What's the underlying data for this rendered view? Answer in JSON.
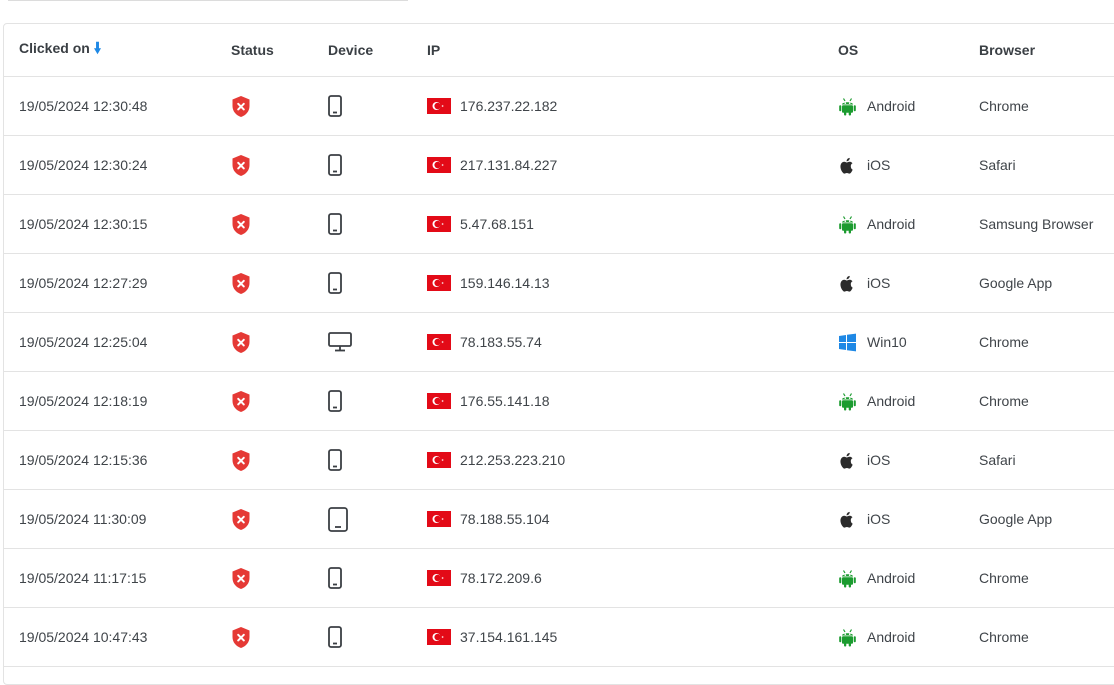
{
  "colors": {
    "accent": "#1e88e5",
    "status_blocked": "#e53935",
    "android": "#1b9b2f",
    "ios": "#2b2b2b",
    "windows": "#1e88e5",
    "flag_red": "#e30a17"
  },
  "table": {
    "headers": {
      "clicked_on": "Clicked on",
      "status": "Status",
      "device": "Device",
      "ip": "IP",
      "os": "OS",
      "browser": "Browser"
    },
    "sort_indicator": "arrow-down-icon",
    "rows": [
      {
        "date": "19/05/2024 12:30:48",
        "status": "blocked",
        "device": "mobile",
        "flag": "turkey-flag-icon",
        "ip": "176.237.22.182",
        "os_icon": "android-icon",
        "os": "Android",
        "browser": "Chrome"
      },
      {
        "date": "19/05/2024 12:30:24",
        "status": "blocked",
        "device": "mobile",
        "flag": "turkey-flag-icon",
        "ip": "217.131.84.227",
        "os_icon": "apple-icon",
        "os": "iOS",
        "browser": "Safari"
      },
      {
        "date": "19/05/2024 12:30:15",
        "status": "blocked",
        "device": "mobile",
        "flag": "turkey-flag-icon",
        "ip": "5.47.68.151",
        "os_icon": "android-icon",
        "os": "Android",
        "browser": "Samsung Browser"
      },
      {
        "date": "19/05/2024 12:27:29",
        "status": "blocked",
        "device": "mobile",
        "flag": "turkey-flag-icon",
        "ip": "159.146.14.13",
        "os_icon": "apple-icon",
        "os": "iOS",
        "browser": "Google App"
      },
      {
        "date": "19/05/2024 12:25:04",
        "status": "blocked",
        "device": "desktop",
        "flag": "turkey-flag-icon",
        "ip": "78.183.55.74",
        "os_icon": "windows-icon",
        "os": "Win10",
        "browser": "Chrome"
      },
      {
        "date": "19/05/2024 12:18:19",
        "status": "blocked",
        "device": "mobile",
        "flag": "turkey-flag-icon",
        "ip": "176.55.141.18",
        "os_icon": "android-icon",
        "os": "Android",
        "browser": "Chrome"
      },
      {
        "date": "19/05/2024 12:15:36",
        "status": "blocked",
        "device": "mobile",
        "flag": "turkey-flag-icon",
        "ip": "212.253.223.210",
        "os_icon": "apple-icon",
        "os": "iOS",
        "browser": "Safari"
      },
      {
        "date": "19/05/2024 11:30:09",
        "status": "blocked",
        "device": "tablet",
        "flag": "turkey-flag-icon",
        "ip": "78.188.55.104",
        "os_icon": "apple-icon",
        "os": "iOS",
        "browser": "Google App"
      },
      {
        "date": "19/05/2024 11:17:15",
        "status": "blocked",
        "device": "mobile",
        "flag": "turkey-flag-icon",
        "ip": "78.172.209.6",
        "os_icon": "android-icon",
        "os": "Android",
        "browser": "Chrome"
      },
      {
        "date": "19/05/2024 10:47:43",
        "status": "blocked",
        "device": "mobile",
        "flag": "turkey-flag-icon",
        "ip": "37.154.161.145",
        "os_icon": "android-icon",
        "os": "Android",
        "browser": "Chrome"
      }
    ]
  }
}
